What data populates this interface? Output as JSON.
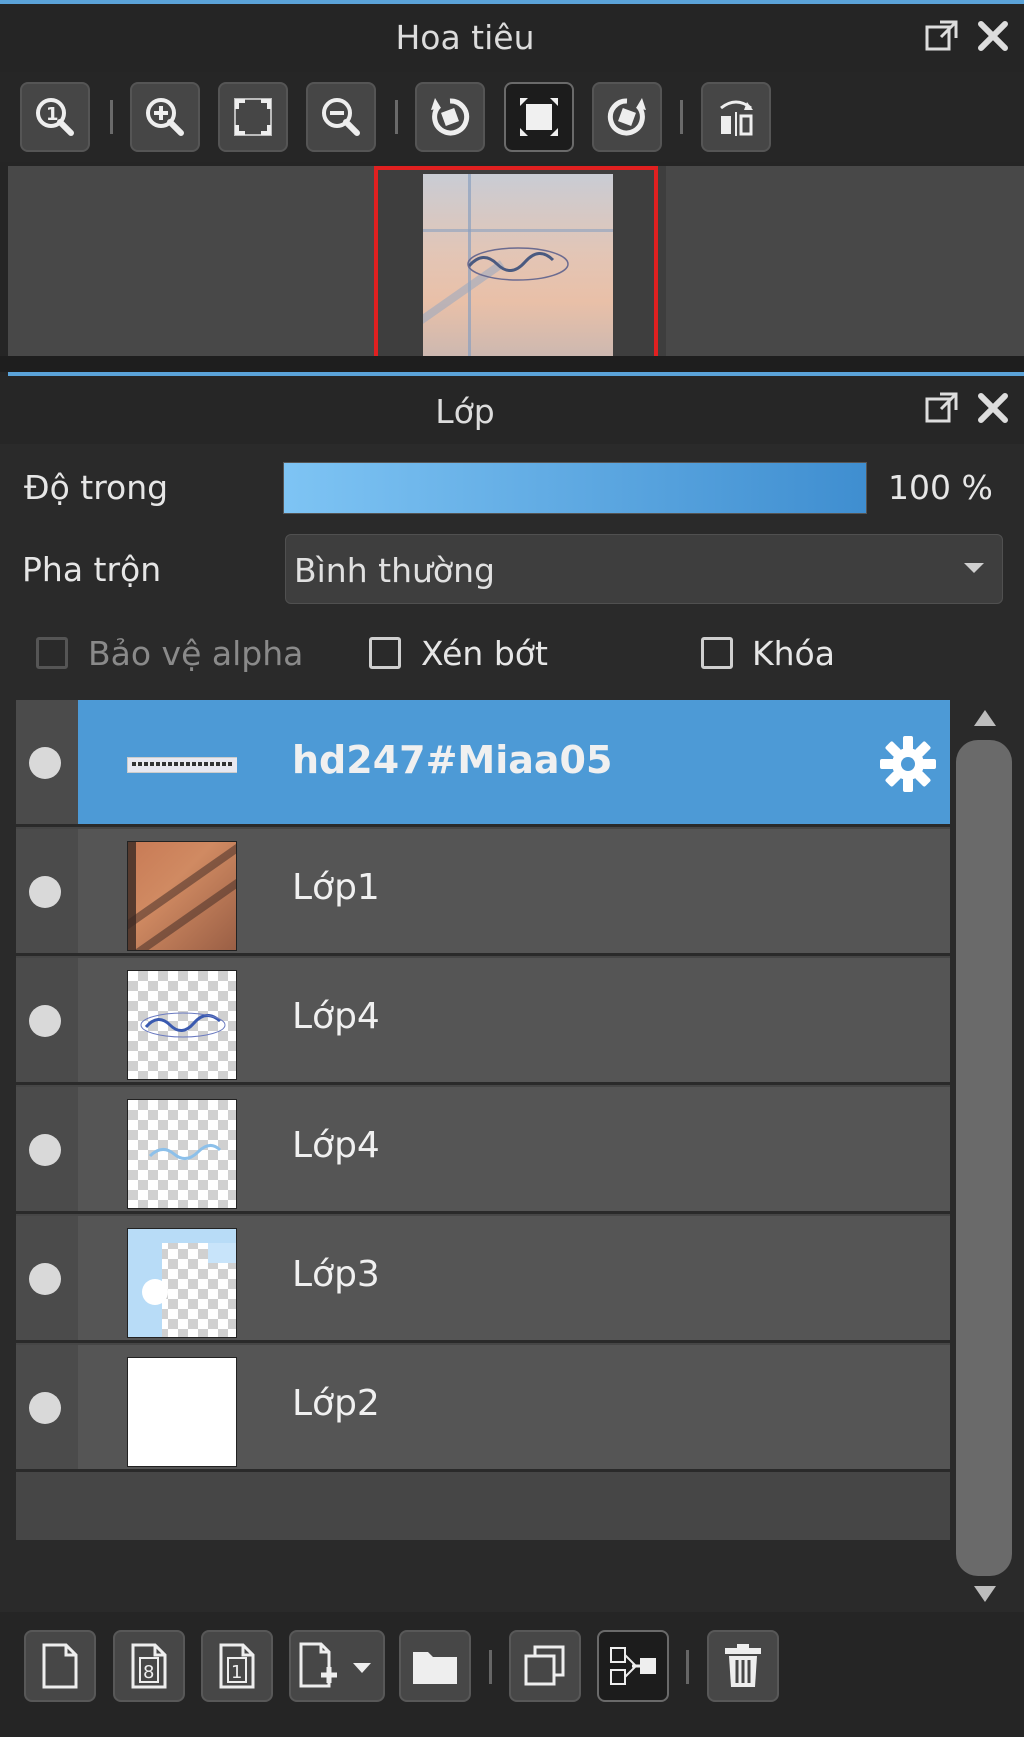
{
  "navigator": {
    "title": "Hoa tiêu",
    "toolbar_icons": [
      "zoom-actual-icon",
      "zoom-in-icon",
      "fit-screen-icon",
      "zoom-out-icon",
      "rotate-left-icon",
      "fullscreen-icon",
      "rotate-right-icon",
      "flip-horizontal-icon"
    ]
  },
  "layers_panel": {
    "title": "Lớp",
    "opacity_label": "Độ trong",
    "opacity_value": "100 %",
    "opacity_fraction": 1.0,
    "blend_label": "Pha trộn",
    "blend_value": "Bình thường",
    "protect_alpha_label": "Bảo vệ alpha",
    "clipping_label": "Xén bớt",
    "lock_label": "Khóa",
    "layers": [
      {
        "name": "hd247#Miaa05",
        "selected": true
      },
      {
        "name": "Lớp1",
        "selected": false
      },
      {
        "name": "Lớp4",
        "selected": false
      },
      {
        "name": "Lớp4",
        "selected": false
      },
      {
        "name": "Lớp3",
        "selected": false
      },
      {
        "name": "Lớp2",
        "selected": false
      }
    ],
    "bottom_icons": [
      "new-layer-icon",
      "new-8bit-layer-icon",
      "new-1bit-layer-icon",
      "add-layer-menu-icon",
      "new-folder-icon",
      "duplicate-layer-icon",
      "merge-down-icon",
      "delete-layer-icon"
    ]
  },
  "colors": {
    "accent": "#4d9ad6",
    "selection_frame": "#e02020"
  }
}
